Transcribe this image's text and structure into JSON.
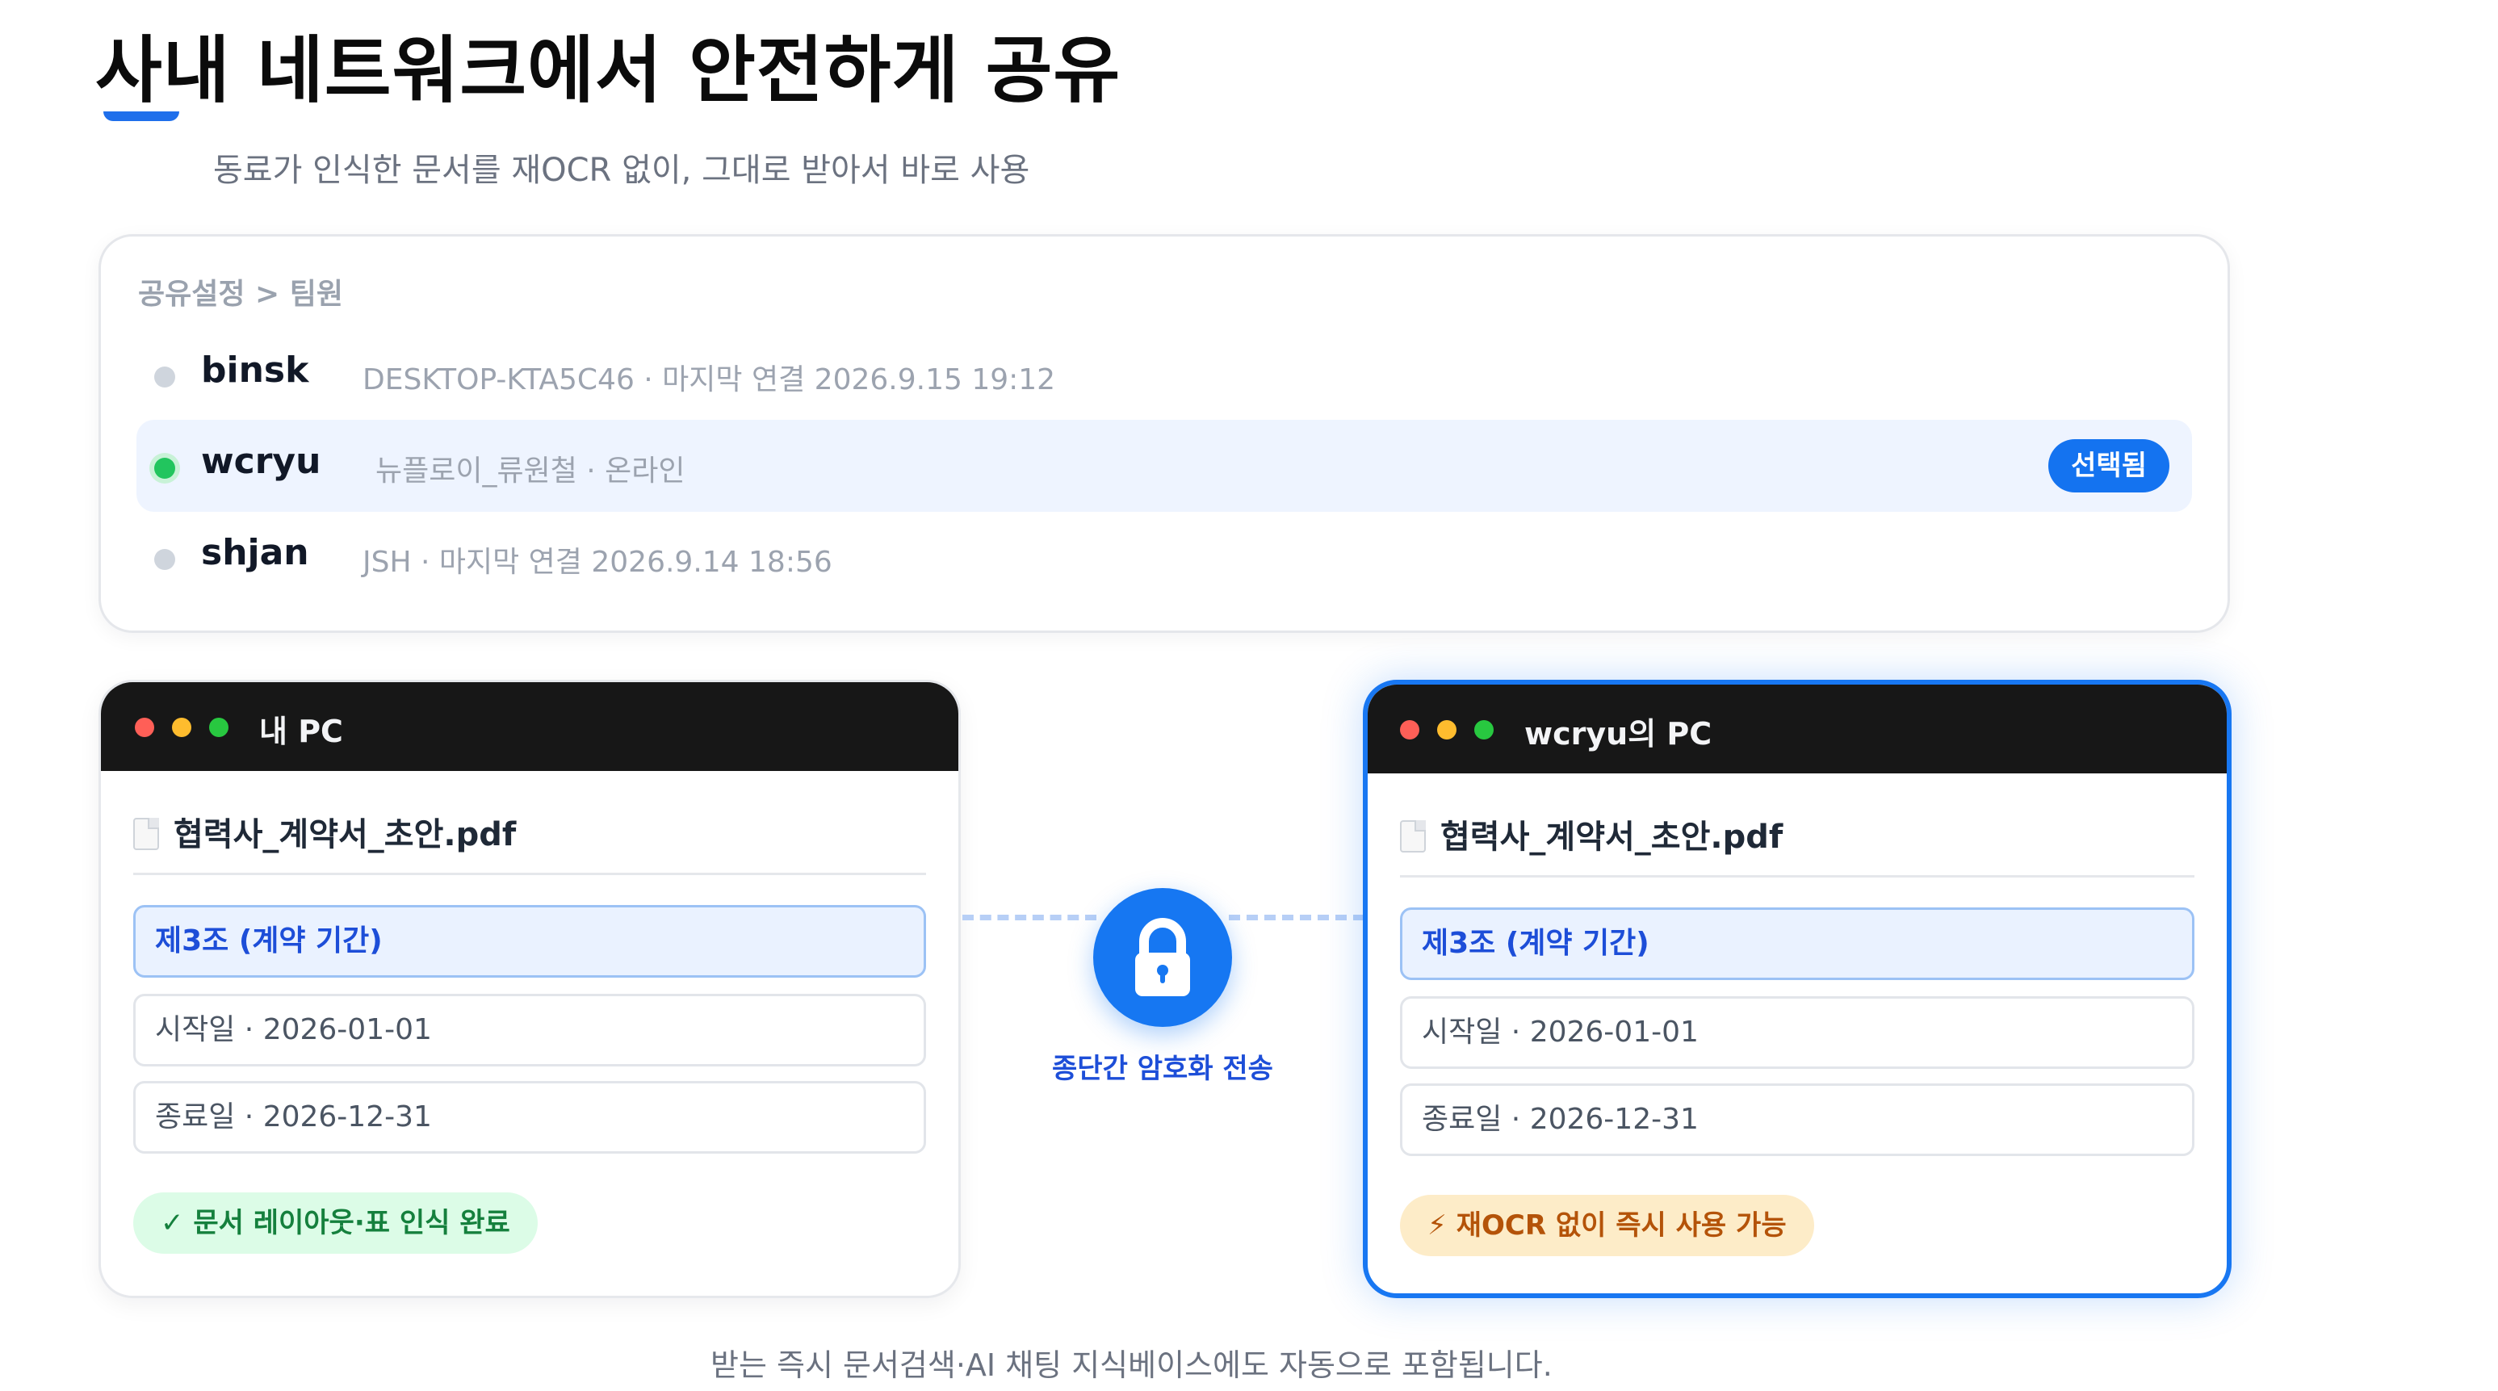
{
  "page": {
    "title": "사내 네트워크에서 안전하게 공유",
    "subtitle": "동료가 인식한 문서를 재OCR 없이, 그대로 받아서 바로 사용",
    "footer": "받는 즉시 문서검색·AI 채팅 지식베이스에도 자동으로 포함됩니다."
  },
  "team_panel": {
    "breadcrumb": "공유설정 > 팀원",
    "members": [
      {
        "name": "binsk",
        "meta": "DESKTOP-KTA5C46 · 마지막 연결 2026.9.15 19:12",
        "online": false
      },
      {
        "name": "wcryu",
        "meta": "뉴플로이_류원철 · 온라인",
        "online": true,
        "badge": "선택됨"
      },
      {
        "name": "shjan",
        "meta": "JSH · 마지막 연결 2026.9.14 18:56",
        "online": false
      }
    ]
  },
  "windows": {
    "local": {
      "title": "내 PC",
      "file_name": "협력사_계약서_초안.pdf",
      "fields": [
        "제3조 (계약 기간)",
        "시작일 · 2026-01-01",
        "종료일 · 2026-12-31"
      ],
      "status": "✓ 문서 레이아웃·표 인식 완료"
    },
    "remote": {
      "title": "wcryu의 PC",
      "file_name": "협력사_계약서_초안.pdf",
      "fields": [
        "제3조 (계약 기간)",
        "시작일 · 2026-01-01",
        "종료일 · 2026-12-31"
      ],
      "status": "⚡ 재OCR 없이 즉시 사용 가능"
    }
  },
  "transfer": {
    "label": "종단간 암호화 전송",
    "icon": "lock-icon"
  },
  "colors": {
    "accent": "#1877f2",
    "online": "#22c55e",
    "titlebar": "#171717",
    "success_bg": "#dcfce7",
    "warn_bg": "#fdecc8"
  }
}
